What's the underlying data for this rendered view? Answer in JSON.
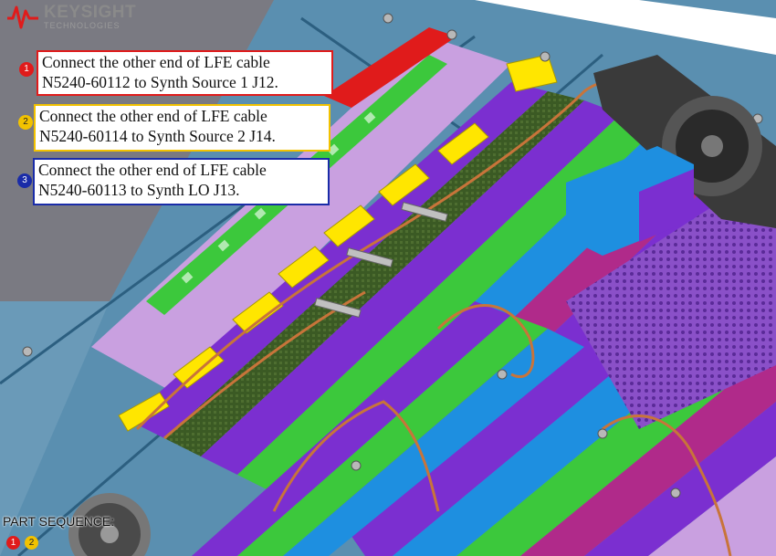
{
  "logo": {
    "name": "KEYSIGHT",
    "subtitle": "TECHNOLOGIES"
  },
  "callouts": [
    {
      "number": "1",
      "line1": "Connect the other end of LFE cable",
      "line2": "N5240-60112 to Synth Source 1 J12.",
      "color": "#e01b1b"
    },
    {
      "number": "2",
      "line1": "Connect the other end of LFE cable",
      "line2": "N5240-60114 to Synth Source 2 J14.",
      "color": "#f2c200"
    },
    {
      "number": "3",
      "line1": "Connect the other end of LFE cable",
      "line2": "N5240-60113 to Synth LO J13.",
      "color": "#1a2ca8"
    }
  ],
  "part_sequence": {
    "label": "PART SEQUENCE:",
    "items": [
      "1",
      "2"
    ]
  },
  "colors": {
    "chassis": "#5a8fb0",
    "board_purple": "#7b2fd0",
    "board_lilac": "#c9a0e0",
    "connector_yellow": "#ffe600",
    "cable_copper": "#c8743a",
    "highlight_red": "#e01b1b",
    "board_green": "#3cc83c",
    "board_blue": "#1e8fe0",
    "board_magenta": "#b02a8a"
  }
}
